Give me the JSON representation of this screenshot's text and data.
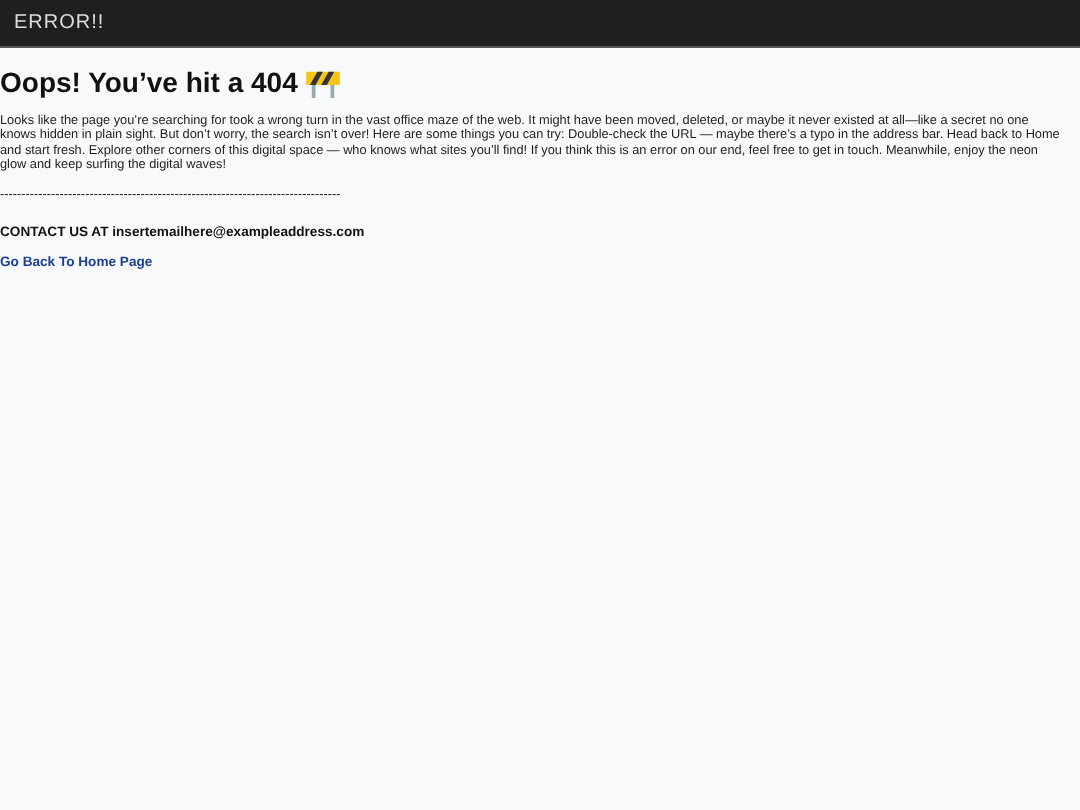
{
  "header": {
    "title": "ERROR!!"
  },
  "heading": "Oops! You’ve hit a 404",
  "message": "Looks like the page you’re searching for took a wrong turn in the vast office maze of the web. It might have been moved, deleted, or maybe it never existed at all—like a secret no one knows hidden in plain sight. But don’t worry, the search isn’t over! Here are some things you can try: Double-check the URL — maybe there’s a typo in the address bar. Head back to Home and start fresh. Explore other corners of this digital space — who knows what sites you’ll find! If you think this is an error on our end, feel free to get in touch. Meanwhile, enjoy the neon glow and keep surfing the digital waves!",
  "divider": "--------------------------------------------------------------------------------",
  "contact": "CONTACT US AT insertemailhere@exampleaddress.com",
  "home_link": "Go Back To Home Page"
}
